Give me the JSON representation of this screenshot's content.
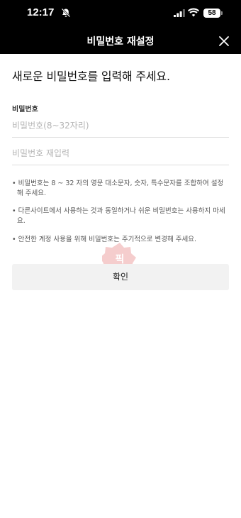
{
  "status_bar": {
    "time": "12:17",
    "battery": "58",
    "icons": [
      "bell-off-icon",
      "signal-icon",
      "wifi-icon",
      "battery-icon"
    ]
  },
  "header": {
    "title": "비밀번호 재설정",
    "close_icon": "close-icon"
  },
  "main": {
    "heading": "새로운 비밀번호를 입력해 주세요.",
    "password_label": "비밀번호",
    "password_placeholder": "비밀번호(8~32자리)",
    "password_confirm_placeholder": "비밀번호 재입력",
    "notices": [
      "• 비밀번호는 8 ~ 32 자의 영문 대소문자, 숫자, 특수문자를 조합하여 설정해 주세요.",
      "• 다른사이트에서 사용하는 것과 동일하거나 쉬운 비밀번호는 사용하지 마세요.",
      "• 안전한 계정 사용을 위해 비밀번호는 주기적으로 변경해 주세요."
    ],
    "confirm_label": "확인"
  },
  "colors": {
    "header_bg": "#000000",
    "button_bg": "#f2f2f2",
    "watermark": "#e57373"
  }
}
